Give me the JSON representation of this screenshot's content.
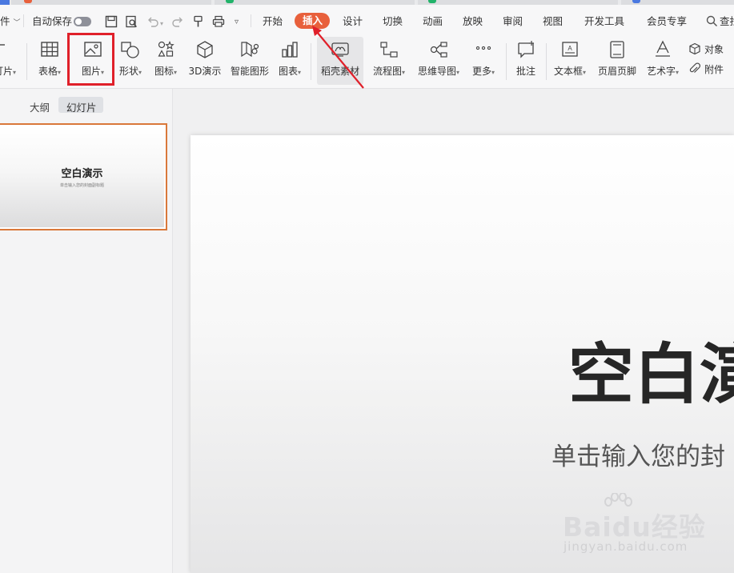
{
  "menubar": {
    "file_menu_label": "件",
    "autosave_label": "自动保存",
    "tabs": [
      "开始",
      "插入",
      "设计",
      "切换",
      "动画",
      "放映",
      "审阅",
      "视图",
      "开发工具",
      "会员专享"
    ],
    "active_tab": "插入",
    "search_label": "查找"
  },
  "ribbon": {
    "items": {
      "new_slide": "灯片",
      "table": "表格",
      "picture": "图片",
      "shape": "形状",
      "icon": "图标",
      "model3d": "3D演示",
      "smartart": "智能图形",
      "chart": "图表",
      "daoke": "稻壳素材",
      "flowchart": "流程图",
      "mindmap": "思维导图",
      "more": "更多",
      "comment": "批注",
      "textbox": "文本框",
      "header_footer": "页眉页脚",
      "wordart": "艺术字",
      "object": "对象",
      "attachment": "附件"
    }
  },
  "panel": {
    "tab_outline": "大纲",
    "tab_slides": "幻灯片",
    "thumb_title": "空白演示",
    "thumb_subtitle": "单击输入您的封面副标题"
  },
  "slide": {
    "title": "空白演",
    "subtitle": "单击输入您的封"
  },
  "watermark": {
    "brand": "Baidu经验",
    "url": "jingyan.baidu.com"
  },
  "colors": {
    "accent": "#e8603c",
    "highlight_box": "#e0202a",
    "arrow": "#e0202a",
    "thumb_border": "#d9783a"
  }
}
